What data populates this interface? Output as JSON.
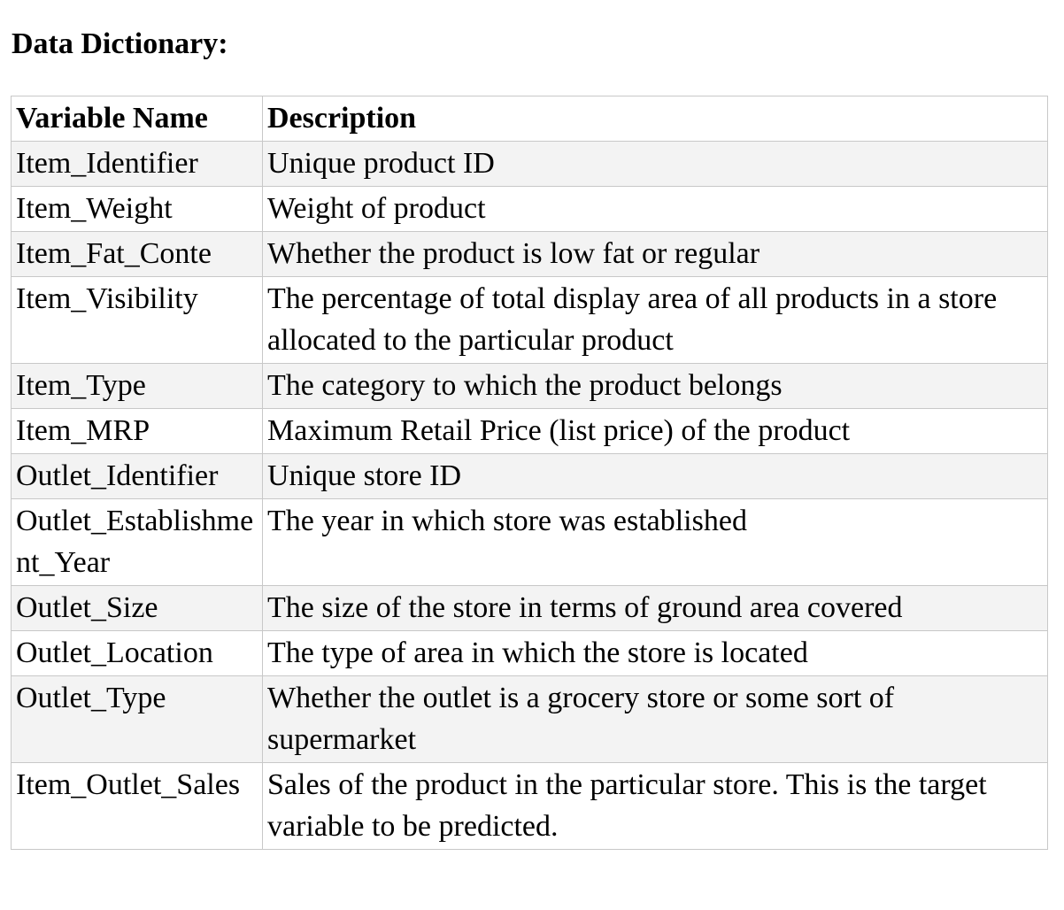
{
  "title": "Data Dictionary:",
  "table": {
    "headers": [
      "Variable Name",
      "Description"
    ],
    "rows": [
      {
        "name": "Item_Identifier",
        "desc": "Unique product ID"
      },
      {
        "name": "Item_Weight",
        "desc": "Weight of product"
      },
      {
        "name": "Item_Fat_Conte",
        "desc": "Whether the product is low fat or regular"
      },
      {
        "name": "Item_Visibility",
        "desc": "The percentage of total display area of all products in a store allocated to the particular product"
      },
      {
        "name": "Item_Type",
        "desc": "The category to which the product belongs"
      },
      {
        "name": "Item_MRP",
        "desc": "Maximum Retail Price (list price) of the product"
      },
      {
        "name": "Outlet_Identifier",
        "desc": "Unique store ID"
      },
      {
        "name": "Outlet_Establishment_Year",
        "desc": "The year in which store was established"
      },
      {
        "name": "Outlet_Size",
        "desc": "The size of the store in terms of ground area covered"
      },
      {
        "name": "Outlet_Location",
        "desc": "The type of area in which the store is located"
      },
      {
        "name": "Outlet_Type",
        "desc": "Whether the outlet is a grocery store or some sort of supermarket"
      },
      {
        "name": "Item_Outlet_Sales",
        "desc": "Sales of the product in the particular store. This is the target variable to be predicted."
      }
    ]
  }
}
